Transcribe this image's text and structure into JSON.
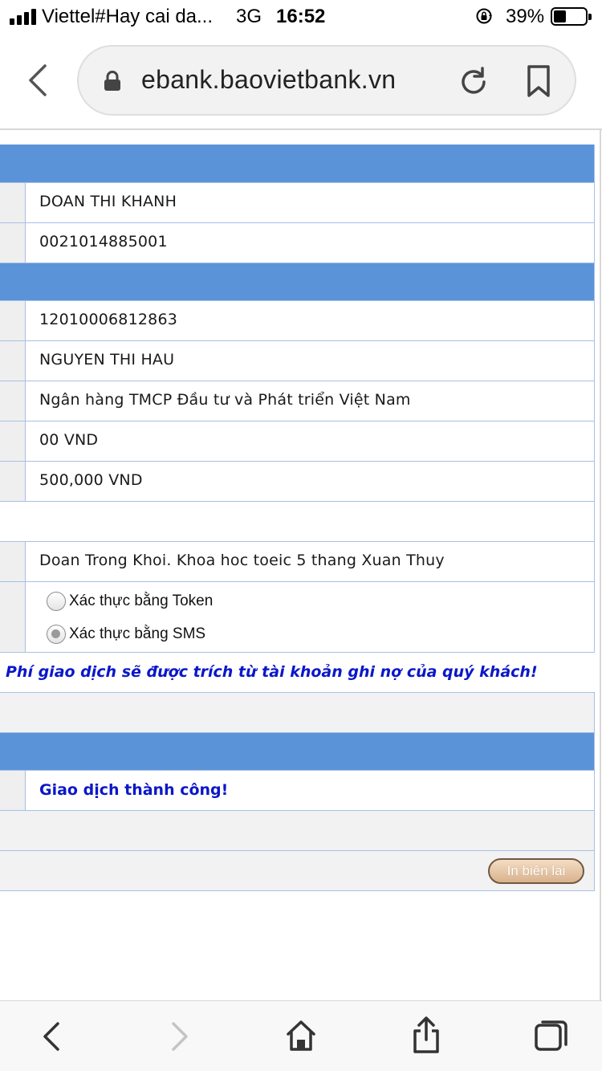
{
  "status_bar": {
    "carrier": "Viettel#Hay cai da...",
    "network": "3G",
    "time": "16:52",
    "battery_percent": "39%",
    "battery_level": 0.39
  },
  "browser": {
    "url": "ebank.baovietbank.vn",
    "icons": {
      "back": "chevron-left-icon",
      "lock": "padlock-icon",
      "reload": "reload-icon",
      "bookmark": "bookmark-icon"
    }
  },
  "transfer": {
    "sender_name": "DOAN THI KHANH",
    "sender_account": "0021014885001",
    "receiver_account": "12010006812863",
    "receiver_name": "NGUYEN THI HAU",
    "receiver_bank": "Ngân hàng TMCP Đầu tư và Phát triển Việt Nam",
    "fee": "00 VND",
    "amount": "500,000 VND",
    "description": "Doan Trong Khoi. Khoa hoc toeic 5 thang Xuan Thuy"
  },
  "auth": {
    "options": [
      {
        "label": "Xác thực bằng Token",
        "checked": false
      },
      {
        "label": "Xác thực bằng SMS",
        "checked": true
      }
    ]
  },
  "messages": {
    "fee_notice": "Phí giao dịch sẽ được trích từ tài khoản ghi nợ của quý khách!",
    "success": "Giao dịch thành công!"
  },
  "actions": {
    "print_receipt": "In biên lai"
  },
  "colors": {
    "band_blue": "#5b93d9",
    "message_blue": "#0a17c8",
    "label_gray": "#efefef"
  }
}
